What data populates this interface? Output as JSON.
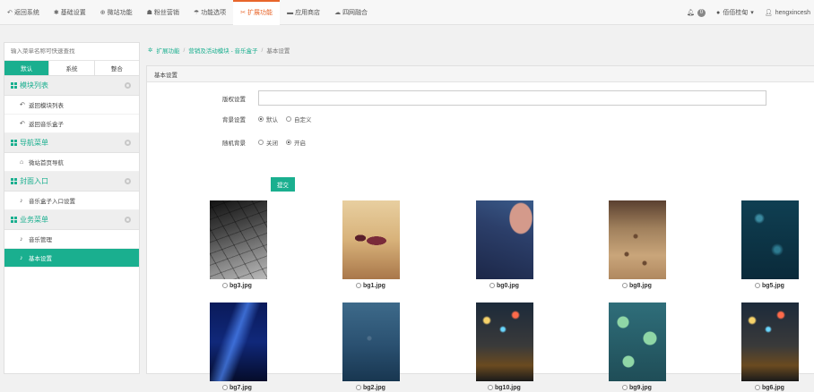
{
  "topnav": [
    {
      "icon": "↶",
      "icon_name": "back-icon",
      "label": "返回系统"
    },
    {
      "icon": "✱",
      "icon_name": "gear-icon",
      "label": "基础设置"
    },
    {
      "icon": "⊕",
      "icon_name": "globe-icon",
      "label": "微站功能"
    },
    {
      "icon": "☗",
      "icon_name": "gift-icon",
      "label": "粉丝营销"
    },
    {
      "icon": "☂",
      "icon_name": "umbrella-icon",
      "label": "功能选项"
    },
    {
      "icon": "✂",
      "icon_name": "extensions-icon",
      "label": "扩展功能"
    },
    {
      "icon": "▬",
      "icon_name": "cart-icon",
      "label": "应用商店"
    },
    {
      "icon": "☁",
      "icon_name": "cloud-icon",
      "label": "四网融合"
    }
  ],
  "topright": {
    "notifications_count": "0",
    "account_label": "佰佰桂甸",
    "user_label": "hengxincesh"
  },
  "sidebar": {
    "search_placeholder": "输入菜单名称可快速查找",
    "tabs": [
      "默认",
      "系统",
      "整合"
    ],
    "groups": [
      {
        "title": "模块列表",
        "links": [
          {
            "icon": "↶",
            "label": "返回模块列表"
          },
          {
            "icon": "↶",
            "label": "返回音乐盒子"
          }
        ]
      },
      {
        "title": "导航菜单",
        "links": [
          {
            "icon": "⌂",
            "label": "微站首页导航"
          }
        ]
      },
      {
        "title": "封面入口",
        "links": [
          {
            "icon": "♪",
            "label": "音乐盒子入口设置"
          }
        ]
      },
      {
        "title": "业务菜单",
        "links": [
          {
            "icon": "♪",
            "label": "音乐管理"
          },
          {
            "icon": "♪",
            "label": "基本设置"
          }
        ]
      }
    ]
  },
  "breadcrumb": [
    "扩展功能",
    "营销及活动模块 - 音乐盒子",
    "基本设置"
  ],
  "panel": {
    "title": "基本设置",
    "copyright_label": "版权设置",
    "copyright_value": "",
    "bg_setting_label": "背景设置",
    "bg_setting_options": [
      "默认",
      "自定义"
    ],
    "bg_setting_selected": 0,
    "random_bg_label": "随机背景",
    "random_bg_options": [
      "关闭",
      "开启"
    ],
    "random_bg_selected": 1,
    "submit_label": "提交"
  },
  "gallery": [
    {
      "name": "bg3.jpg"
    },
    {
      "name": "bg1.jpg"
    },
    {
      "name": "bg0.jpg"
    },
    {
      "name": "bg8.jpg"
    },
    {
      "name": "bg5.jpg"
    },
    {
      "name": "bg7.jpg"
    },
    {
      "name": "bg2.jpg"
    },
    {
      "name": "bg10.jpg"
    },
    {
      "name": "bg9.jpg"
    },
    {
      "name": "bg6.jpg"
    }
  ],
  "colors": {
    "accent": "#1aaf8f",
    "active_tab": "#e8662b"
  }
}
